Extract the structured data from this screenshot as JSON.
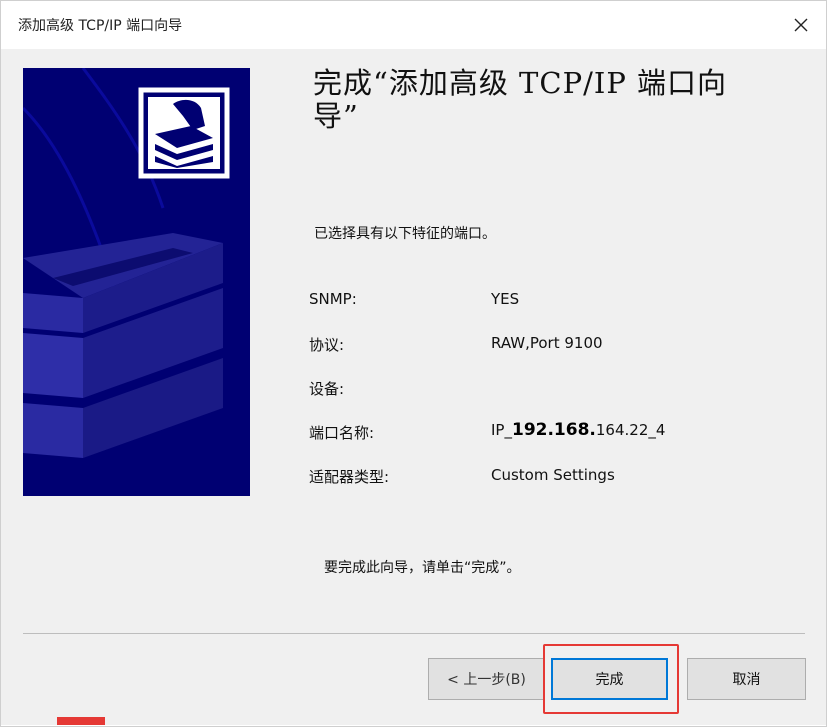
{
  "window": {
    "title": "添加高级 TCP/IP 端口向导",
    "close_icon": "close-icon"
  },
  "banner": {
    "icon": "printer-wizard-icon",
    "background_color": "#000072"
  },
  "heading": "完成“添加高级 TCP/IP 端口向导”",
  "intro": "已选择具有以下特征的端口。",
  "details": {
    "snmp": {
      "label": "SNMP:",
      "value": "YES"
    },
    "protocol": {
      "label": "协议:",
      "value": "RAW,Port 9100"
    },
    "device": {
      "label": "设备:",
      "value": ""
    },
    "port_name": {
      "label": "端口名称:",
      "value_prefix": "IP_",
      "value_bold": "192.168.",
      "value_suffix": "164.22_4"
    },
    "adapter_type": {
      "label": "适配器类型:",
      "value": "Custom Settings"
    }
  },
  "finish_note": "要完成此向导，请单击“完成”。",
  "buttons": {
    "back": "< 上一步(B)",
    "finish": "完成",
    "cancel": "取消"
  },
  "colors": {
    "highlight": "#e53935",
    "accent": "#0078d7"
  }
}
